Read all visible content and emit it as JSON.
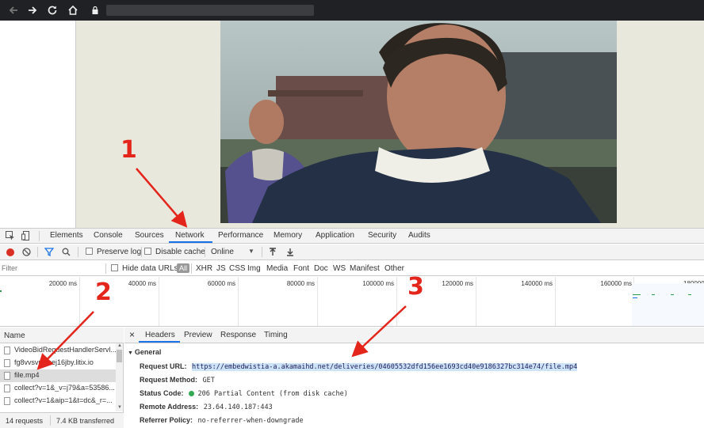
{
  "browser": {
    "back_icon": "back-arrow-icon",
    "forward_icon": "forward-arrow-icon",
    "reload_icon": "reload-icon",
    "home_icon": "home-icon",
    "lock_icon": "lock-icon"
  },
  "devtools": {
    "tabs": [
      "Elements",
      "Console",
      "Sources",
      "Network",
      "Performance",
      "Memory",
      "Application",
      "Security",
      "Audits"
    ],
    "active_tab": "Network",
    "toolbar": {
      "preserve_log": "Preserve log",
      "disable_cache": "Disable cache",
      "throttle": "Online"
    },
    "filter": {
      "placeholder": "Filter",
      "hide_data_urls": "Hide data URLs",
      "types": [
        "All",
        "XHR",
        "JS",
        "CSS",
        "Img",
        "Media",
        "Font",
        "Doc",
        "WS",
        "Manifest",
        "Other"
      ]
    },
    "timeline_ticks": [
      "20000 ms",
      "40000 ms",
      "60000 ms",
      "80000 ms",
      "100000 ms",
      "120000 ms",
      "140000 ms",
      "160000 ms",
      "180000"
    ],
    "requests": {
      "header": "Name",
      "rows": [
        "VideoBidRequestHandlerServl...",
        "fg8vvsvnj8sej16jby.litix.io",
        "file.mp4",
        "collect?v=1&_v=j79&a=53586...",
        "collect?v=1&aip=1&t=dc&_r=..."
      ],
      "footer_requests": "14 requests",
      "footer_transferred": "7.4 KB transferred"
    },
    "detail": {
      "close": "×",
      "tabs": [
        "Headers",
        "Preview",
        "Response",
        "Timing"
      ],
      "section": "General",
      "fields": [
        {
          "key": "Request URL:",
          "value": "https://embedwistia-a.akamaihd.net/deliveries/04605532dfd156ee1693cd40e9186327bc314e74/file.mp4"
        },
        {
          "key": "Request Method:",
          "value": "GET"
        },
        {
          "key": "Status Code:",
          "value": "206 Partial Content (from disk cache)"
        },
        {
          "key": "Remote Address:",
          "value": "23.64.140.187:443"
        },
        {
          "key": "Referrer Policy:",
          "value": "no-referrer-when-downgrade"
        }
      ]
    }
  },
  "annotations": [
    "1",
    "2",
    "3"
  ],
  "colors": {
    "accent": "#1a73e8",
    "annotation": "#e3251b",
    "record": "#d93025",
    "status_ok": "#34a853"
  }
}
